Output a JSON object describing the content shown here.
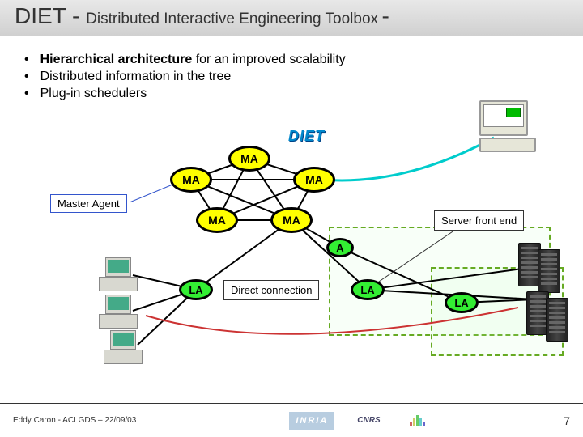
{
  "title": {
    "main": "DIET - ",
    "sub": "Distributed Interactive Engineering Toolbox",
    "trail": " -"
  },
  "bullets": [
    {
      "bold": "Hierarchical architecture",
      "rest": " for an improved scalability"
    },
    {
      "bold": "",
      "rest": "Distributed information in the tree"
    },
    {
      "bold": "",
      "rest": "Plug-in schedulers"
    }
  ],
  "labels": {
    "masterAgent": "Master Agent",
    "directConnection": "Direct connection",
    "serverFrontEnd": "Server front end"
  },
  "nodes": {
    "ma1": "MA",
    "ma2": "MA",
    "ma3": "MA",
    "ma4": "MA",
    "ma5": "MA",
    "la1": "LA",
    "la2": "LA",
    "la3": "LA",
    "a": "A"
  },
  "logo": {
    "text": "DIET"
  },
  "footer": {
    "left": "Eddy Caron - ACI GDS – 22/09/03",
    "inria": "INRIA",
    "cnrs": "CNRS",
    "pageNum": "7"
  }
}
